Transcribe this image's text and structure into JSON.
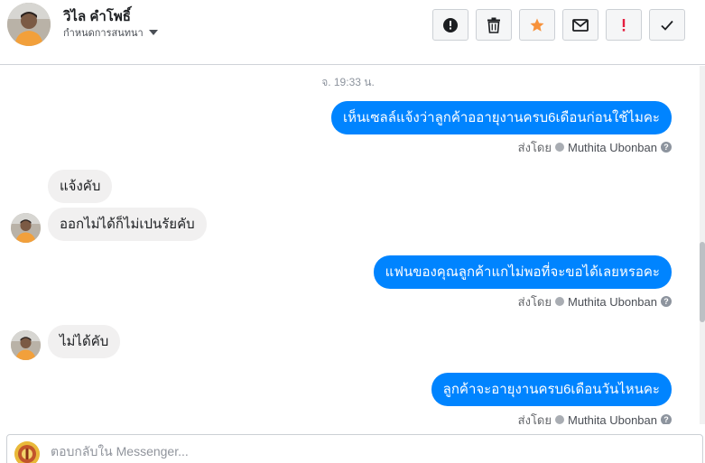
{
  "header": {
    "contact_name": "วิไล คำโพธิ์",
    "conversation_settings_label": "กำหนดการสนทนา",
    "toolbar": [
      {
        "name": "block-button",
        "icon": "exclamation-circle-icon"
      },
      {
        "name": "delete-button",
        "icon": "trash-icon"
      },
      {
        "name": "star-button",
        "icon": "star-icon"
      },
      {
        "name": "mark-unread-button",
        "icon": "envelope-icon"
      },
      {
        "name": "spam-button",
        "icon": "exclamation-mark-icon"
      },
      {
        "name": "done-button",
        "icon": "checkmark-icon"
      }
    ]
  },
  "thread": {
    "timestamp": "จ. 19:33 น.",
    "sent_by_label": "ส่งโดย",
    "sender_name": "Muthita Ubonban",
    "messages": [
      {
        "direction": "out",
        "text": "เห็นเซลล์แจ้งว่าลูกค้าออายุงานครบ6เดือนก่อนใช้ไมคะ"
      },
      {
        "direction": "in",
        "text": "แจ้งคับ"
      },
      {
        "direction": "in",
        "text": "ออกไม่ได้ก็ไม่เปนรัยคับ"
      },
      {
        "direction": "out",
        "text": "แฟนของคุณลูกค้าแกไม่พอที่จะขอได้เลยหรอคะ"
      },
      {
        "direction": "in",
        "text": "ไม่ได้คับ"
      },
      {
        "direction": "out",
        "text": "ลูกค้าจะอายุงานครบ6เดือนวันไหนคะ"
      }
    ]
  },
  "composer": {
    "placeholder": "ตอบกลับใน Messenger..."
  },
  "colors": {
    "outgoing_bubble": "#0084ff",
    "incoming_bubble": "#f1f0f0",
    "star": "#f7923b",
    "spam": "#e41e3f"
  }
}
